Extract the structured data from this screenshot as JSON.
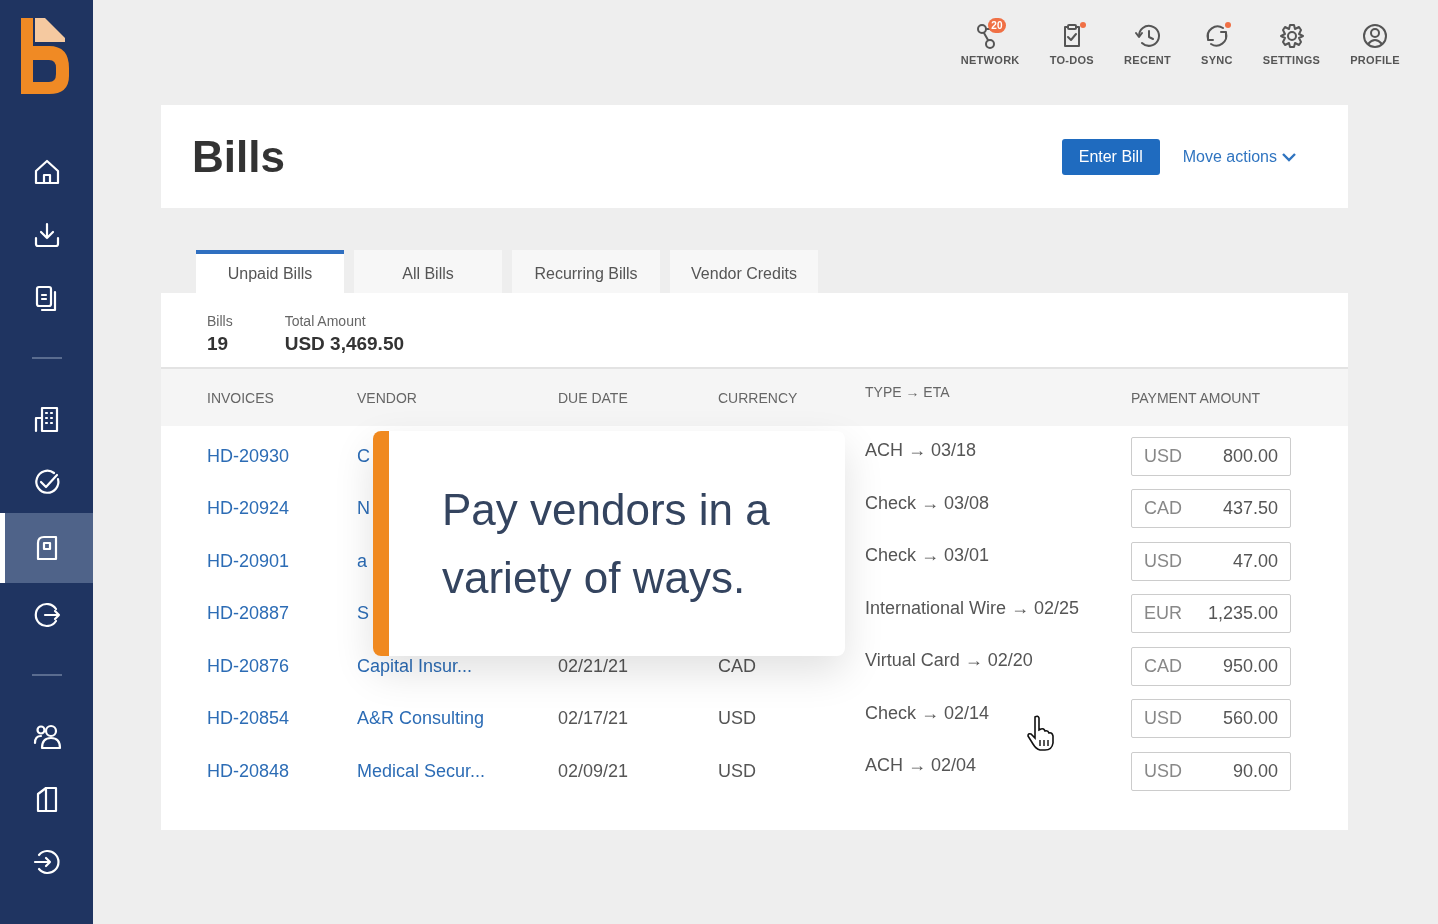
{
  "sidebar": {
    "items": [
      {
        "kind": "home",
        "selected": false
      },
      {
        "kind": "download",
        "selected": false
      },
      {
        "kind": "documents",
        "selected": false
      },
      {
        "kind": "divider"
      },
      {
        "kind": "building",
        "selected": false
      },
      {
        "kind": "approve",
        "selected": false
      },
      {
        "kind": "bill",
        "selected": true
      },
      {
        "kind": "export",
        "selected": false
      },
      {
        "kind": "divider"
      },
      {
        "kind": "people",
        "selected": false
      },
      {
        "kind": "door",
        "selected": false
      },
      {
        "kind": "login",
        "selected": false
      }
    ]
  },
  "topbar": [
    {
      "kind": "network",
      "label": "NETWORK",
      "badge": "20",
      "dot": false
    },
    {
      "kind": "todos",
      "label": "TO-DOS",
      "dot": true
    },
    {
      "kind": "recent",
      "label": "RECENT",
      "dot": false
    },
    {
      "kind": "sync",
      "label": "SYNC",
      "dot": true
    },
    {
      "kind": "settings",
      "label": "SETTINGS",
      "dot": false
    },
    {
      "kind": "profile",
      "label": "PROFILE",
      "dot": false
    }
  ],
  "header": {
    "title": "Bills",
    "primary_button": "Enter Bill",
    "actions_menu": "Move actions"
  },
  "tabs": [
    {
      "label": "Unpaid Bills",
      "selected": true
    },
    {
      "label": "All Bills",
      "selected": false
    },
    {
      "label": "Recurring Bills",
      "selected": false
    },
    {
      "label": "Vendor Credits",
      "selected": false
    }
  ],
  "summary": [
    {
      "label": "Bills",
      "value": "19"
    },
    {
      "label": "Total Amount",
      "value": "USD 3,469.50"
    }
  ],
  "table": {
    "columns": [
      "INVOICES",
      "VENDOR",
      "DUE DATE",
      "CURRENCY",
      "TYPE → ETA",
      "PAYMENT AMOUNT"
    ],
    "rows": [
      {
        "invoice": "HD-20930",
        "vendor": "C",
        "type_eta": "ACH → 03/18",
        "pay_currency": "USD",
        "amount": "800.00"
      },
      {
        "invoice": "HD-20924",
        "vendor": "N",
        "type_eta": "Check → 03/08",
        "pay_currency": "CAD",
        "amount": "437.50"
      },
      {
        "invoice": "HD-20901",
        "vendor": "a",
        "type_eta": "Check → 03/01",
        "pay_currency": "USD",
        "amount": "47.00"
      },
      {
        "invoice": "HD-20887",
        "vendor": "S",
        "type_eta": "International Wire → 02/25",
        "pay_currency": "EUR",
        "amount": "1,235.00"
      },
      {
        "invoice": "HD-20876",
        "vendor": "Capital Insur...",
        "due_date": "02/21/21",
        "currency": "CAD",
        "type_eta": "Virtual Card → 02/20",
        "pay_currency": "CAD",
        "amount": "950.00"
      },
      {
        "invoice": "HD-20854",
        "vendor": "A&R Consulting",
        "due_date": "02/17/21",
        "currency": "USD",
        "type_eta": "Check → 02/14",
        "pay_currency": "USD",
        "amount": "560.00"
      },
      {
        "invoice": "HD-20848",
        "vendor": "Medical Secur...",
        "due_date": "02/09/21",
        "currency": "USD",
        "type_eta": "ACH → 02/04",
        "pay_currency": "USD",
        "amount": "90.00"
      }
    ]
  },
  "callout": {
    "text": "Pay vendors in a variety of ways."
  }
}
